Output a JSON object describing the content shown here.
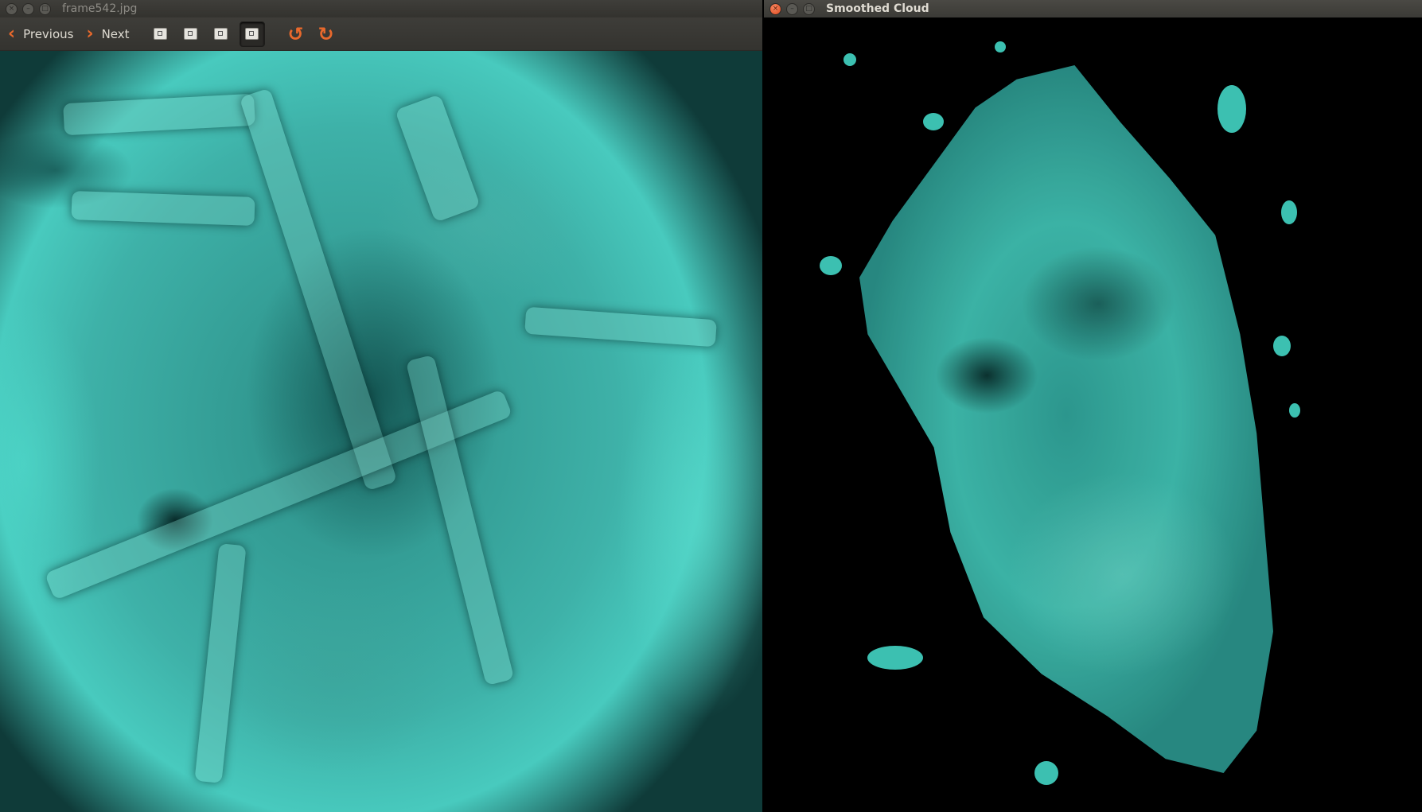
{
  "left_window": {
    "title": "frame542.jpg",
    "controls": {
      "close": "×",
      "minimize": "–",
      "maximize": "□"
    },
    "toolbar": {
      "previous_label": "Previous",
      "next_label": "Next",
      "previous_icon": "chevron-left-icon",
      "next_icon": "chevron-right-icon",
      "tools": [
        "zoom-in-icon",
        "zoom-fit-width-icon",
        "zoom-fit-page-icon",
        "zoom-best-fit-icon",
        "rotate-left-icon",
        "rotate-right-icon"
      ],
      "accent_color": "#e9692c"
    },
    "image": {
      "content": "underwater-wreck-photo"
    }
  },
  "right_window": {
    "title": "Smoothed Cloud",
    "controls": {
      "close": "×",
      "minimize": "–",
      "maximize": "□"
    },
    "view": {
      "content": "point-cloud-reconstruction",
      "background": "#000000"
    }
  }
}
